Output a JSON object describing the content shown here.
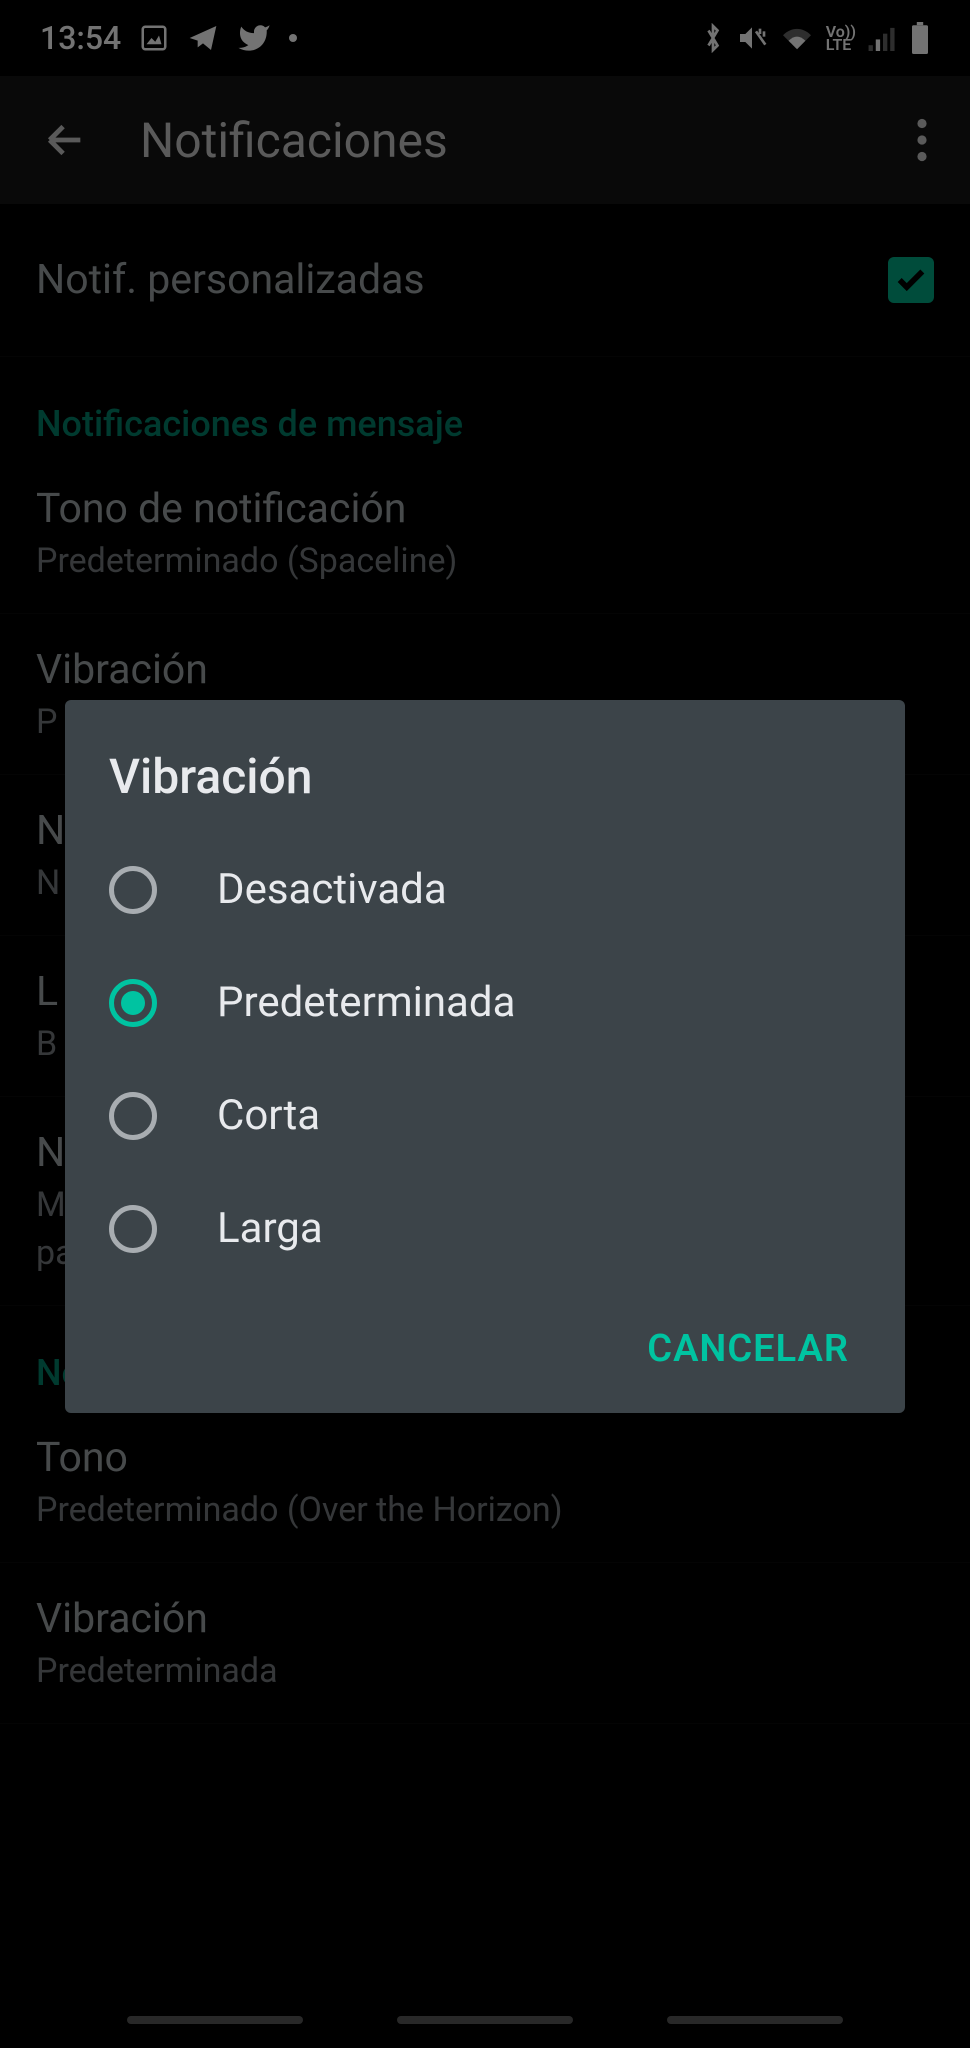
{
  "status": {
    "time": "13:54"
  },
  "appbar": {
    "title": "Notificaciones"
  },
  "sections": {
    "customRow": {
      "title": "Notif. personalizadas"
    },
    "messageHeader": "Notificaciones de mensaje",
    "tone": {
      "title": "Tono de notificación",
      "subtitle": "Predeterminado (Spaceline)"
    },
    "vibration": {
      "title": "Vibración",
      "subtitle": "P"
    },
    "popup": {
      "title": "N",
      "subtitle": "N"
    },
    "light": {
      "title": "L",
      "subtitle": "B"
    },
    "priority": {
      "title": "N",
      "subtitle1": "M",
      "subtitle2": "pa"
    },
    "callsHeader": "Notificaciones de llamadas",
    "callTone": {
      "title": "Tono",
      "subtitle": "Predeterminado (Over the Horizon)"
    },
    "callVibration": {
      "title": "Vibración",
      "subtitle": "Predeterminada"
    }
  },
  "dialog": {
    "title": "Vibración",
    "options": [
      "Desactivada",
      "Predeterminada",
      "Corta",
      "Larga"
    ],
    "selectedIndex": 1,
    "cancel": "CANCELAR"
  }
}
